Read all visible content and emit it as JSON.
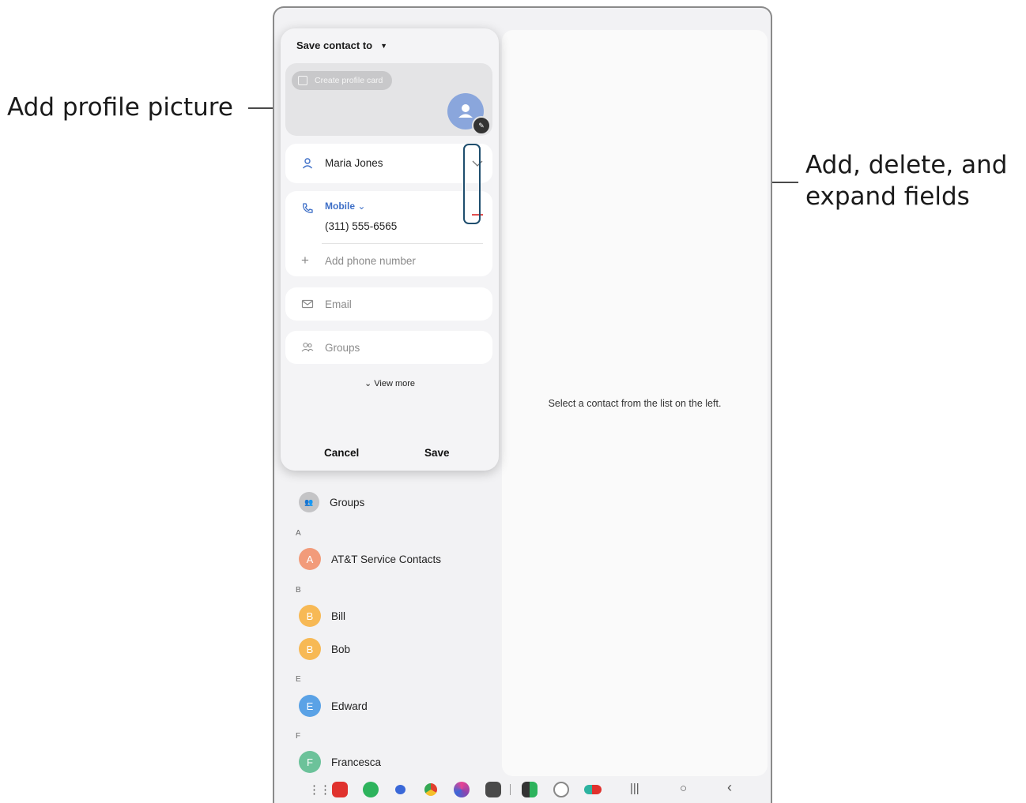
{
  "callouts": {
    "profile_picture": "Add profile picture",
    "fields_line1": "Add, delete, and",
    "fields_line2": "expand fields"
  },
  "dialog": {
    "title": "Save contact to",
    "create_profile_card": "Create profile card",
    "name_value": "Maria Jones",
    "phone_type": "Mobile",
    "phone_value": "(311) 555-6565",
    "add_phone_placeholder": "Add phone number",
    "email_placeholder": "Email",
    "groups_placeholder": "Groups",
    "view_more": "View more",
    "cancel_label": "Cancel",
    "save_label": "Save"
  },
  "detail_pane": {
    "empty_message": "Select a contact from the list on the left."
  },
  "contacts": {
    "groups_label": "Groups",
    "sections": [
      {
        "letter": "A",
        "items": [
          {
            "initial": "A",
            "name": "AT&T Service Contacts",
            "color": "#f29b7a"
          }
        ]
      },
      {
        "letter": "B",
        "items": [
          {
            "initial": "B",
            "name": "Bill",
            "color": "#f7b955"
          },
          {
            "initial": "B",
            "name": "Bob",
            "color": "#f7b955"
          }
        ]
      },
      {
        "letter": "E",
        "items": [
          {
            "initial": "E",
            "name": "Edward",
            "color": "#5aa2e6"
          }
        ]
      },
      {
        "letter": "F",
        "items": [
          {
            "initial": "F",
            "name": "Francesca",
            "color": "#6cc29a"
          }
        ]
      }
    ]
  },
  "colors": {
    "accent_blue": "#3e6fc7",
    "delete_red": "#e25050",
    "callout_box": "#1f4e6e"
  },
  "dock": {
    "apps": [
      "apps-grid-icon",
      "red-app-icon",
      "phone-app-icon",
      "messages-app-icon",
      "chrome-app-icon",
      "bixby-app-icon",
      "camera-app-icon",
      "dual-app-icon",
      "verizon-app-icon",
      "mixed-app-icon"
    ],
    "nav": {
      "recents": "|||",
      "home": "○",
      "back": "‹"
    }
  }
}
